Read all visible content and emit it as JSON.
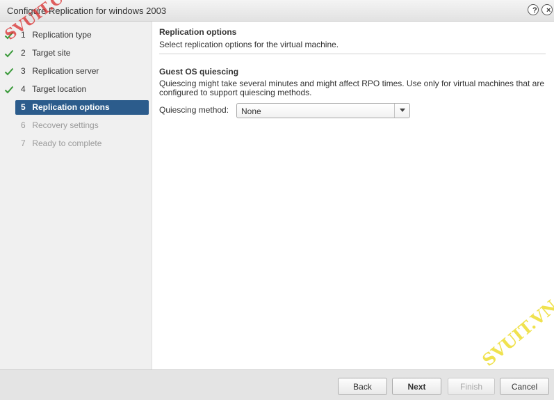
{
  "window": {
    "title": "Configure Replication for windows 2003",
    "help_glyph": "?",
    "close_glyph": "×"
  },
  "steps": [
    {
      "num": "1",
      "label": "Replication type",
      "state": "done"
    },
    {
      "num": "2",
      "label": "Target site",
      "state": "done"
    },
    {
      "num": "3",
      "label": "Replication server",
      "state": "done"
    },
    {
      "num": "4",
      "label": "Target location",
      "state": "done"
    },
    {
      "num": "5",
      "label": "Replication options",
      "state": "active"
    },
    {
      "num": "6",
      "label": "Recovery settings",
      "state": "pending"
    },
    {
      "num": "7",
      "label": "Ready to complete",
      "state": "pending"
    }
  ],
  "content": {
    "title": "Replication options",
    "description": "Select replication options for the virtual machine.",
    "section_title": "Guest OS quiescing",
    "section_description": "Quiescing might take several minutes and might affect RPO times. Use only for virtual machines that are configured to support quiescing methods.",
    "quiescing_label": "Quiescing method:",
    "quiescing_value": "None"
  },
  "footer": {
    "back": "Back",
    "next": "Next",
    "finish": "Finish",
    "cancel": "Cancel"
  },
  "watermarks": {
    "top_left": "SVUIT.COM",
    "bottom_right": "SVUIT.VN"
  },
  "colors": {
    "active_step": "#2c5c8c",
    "check": "#3a9a3a"
  },
  "icons": {
    "done_step": "check-icon",
    "select": "chevron-down-icon"
  }
}
